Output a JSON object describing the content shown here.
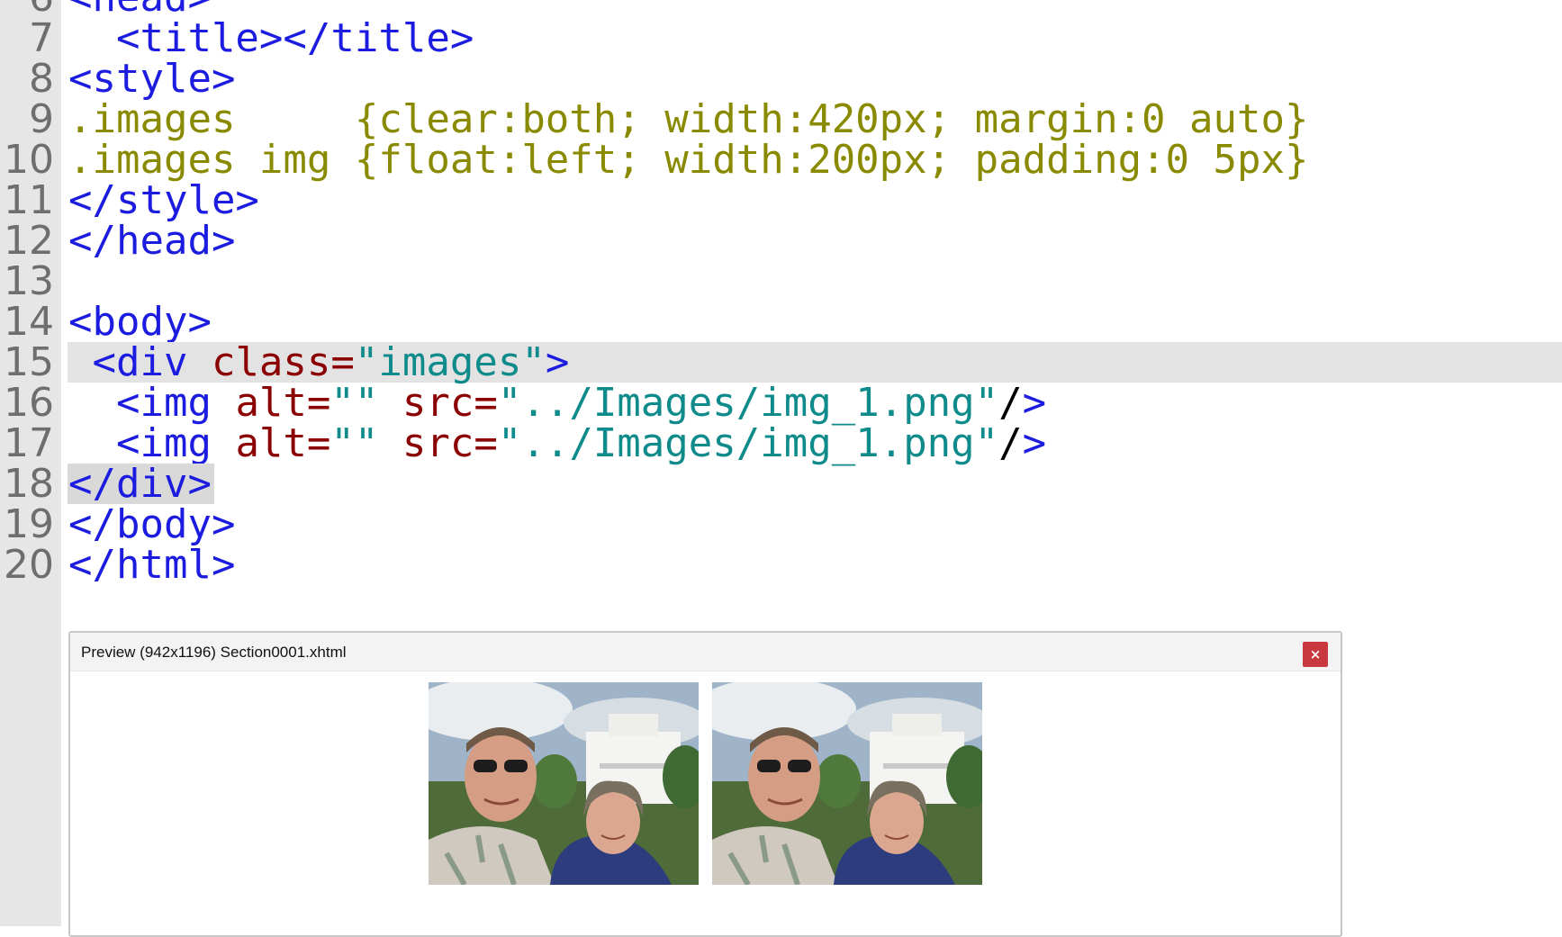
{
  "editor": {
    "lines": [
      {
        "num": "6",
        "parts": [
          {
            "t": "<head>",
            "c": "tag"
          }
        ]
      },
      {
        "num": "7",
        "parts": [
          {
            "t": "  <title></title>",
            "c": "tag"
          }
        ]
      },
      {
        "num": "8",
        "parts": [
          {
            "t": "<style>",
            "c": "tag"
          }
        ]
      },
      {
        "num": "9",
        "parts": [
          {
            "t": ".images     {clear:both; width:420px; margin:0 auto}",
            "c": "css"
          }
        ]
      },
      {
        "num": "10",
        "parts": [
          {
            "t": ".images img {float:left; width:200px; padding:0 5px}",
            "c": "css"
          }
        ]
      },
      {
        "num": "11",
        "parts": [
          {
            "t": "</style>",
            "c": "tag"
          }
        ]
      },
      {
        "num": "12",
        "parts": [
          {
            "t": "</head>",
            "c": "tag"
          }
        ]
      },
      {
        "num": "13",
        "parts": []
      },
      {
        "num": "14",
        "parts": [
          {
            "t": "<body>",
            "c": "tag"
          }
        ]
      },
      {
        "num": "15",
        "highlight": "line",
        "parts": [
          {
            "t": " <div ",
            "c": "tag"
          },
          {
            "t": "class=",
            "c": "attr"
          },
          {
            "t": "\"images\"",
            "c": "str"
          },
          {
            "t": ">",
            "c": "tag"
          }
        ]
      },
      {
        "num": "16",
        "parts": [
          {
            "t": "  <img ",
            "c": "tag"
          },
          {
            "t": "alt=",
            "c": "attr"
          },
          {
            "t": "\"\" ",
            "c": "str"
          },
          {
            "t": "src=",
            "c": "attr"
          },
          {
            "t": "\"../Images/img_1.png\"",
            "c": "str"
          },
          {
            "t": "/",
            "c": "plain"
          },
          {
            "t": ">",
            "c": "tag"
          }
        ]
      },
      {
        "num": "17",
        "parts": [
          {
            "t": "  <img ",
            "c": "tag"
          },
          {
            "t": "alt=",
            "c": "attr"
          },
          {
            "t": "\"\" ",
            "c": "str"
          },
          {
            "t": "src=",
            "c": "attr"
          },
          {
            "t": "\"../Images/img_1.png\"",
            "c": "str"
          },
          {
            "t": "/",
            "c": "plain"
          },
          {
            "t": ">",
            "c": "tag"
          }
        ]
      },
      {
        "num": "18",
        "highlight": "selection",
        "parts": [
          {
            "t": "</div>",
            "c": "tag"
          }
        ]
      },
      {
        "num": "19",
        "parts": [
          {
            "t": "</body>",
            "c": "tag"
          }
        ]
      },
      {
        "num": "20",
        "parts": [
          {
            "t": "</html>",
            "c": "tag"
          }
        ]
      }
    ]
  },
  "preview": {
    "title": "Preview (942x1196) Section0001.xhtml",
    "close_label": "×",
    "images": [
      {
        "name": "preview-image-1",
        "alt": ""
      },
      {
        "name": "preview-image-2",
        "alt": ""
      }
    ]
  }
}
